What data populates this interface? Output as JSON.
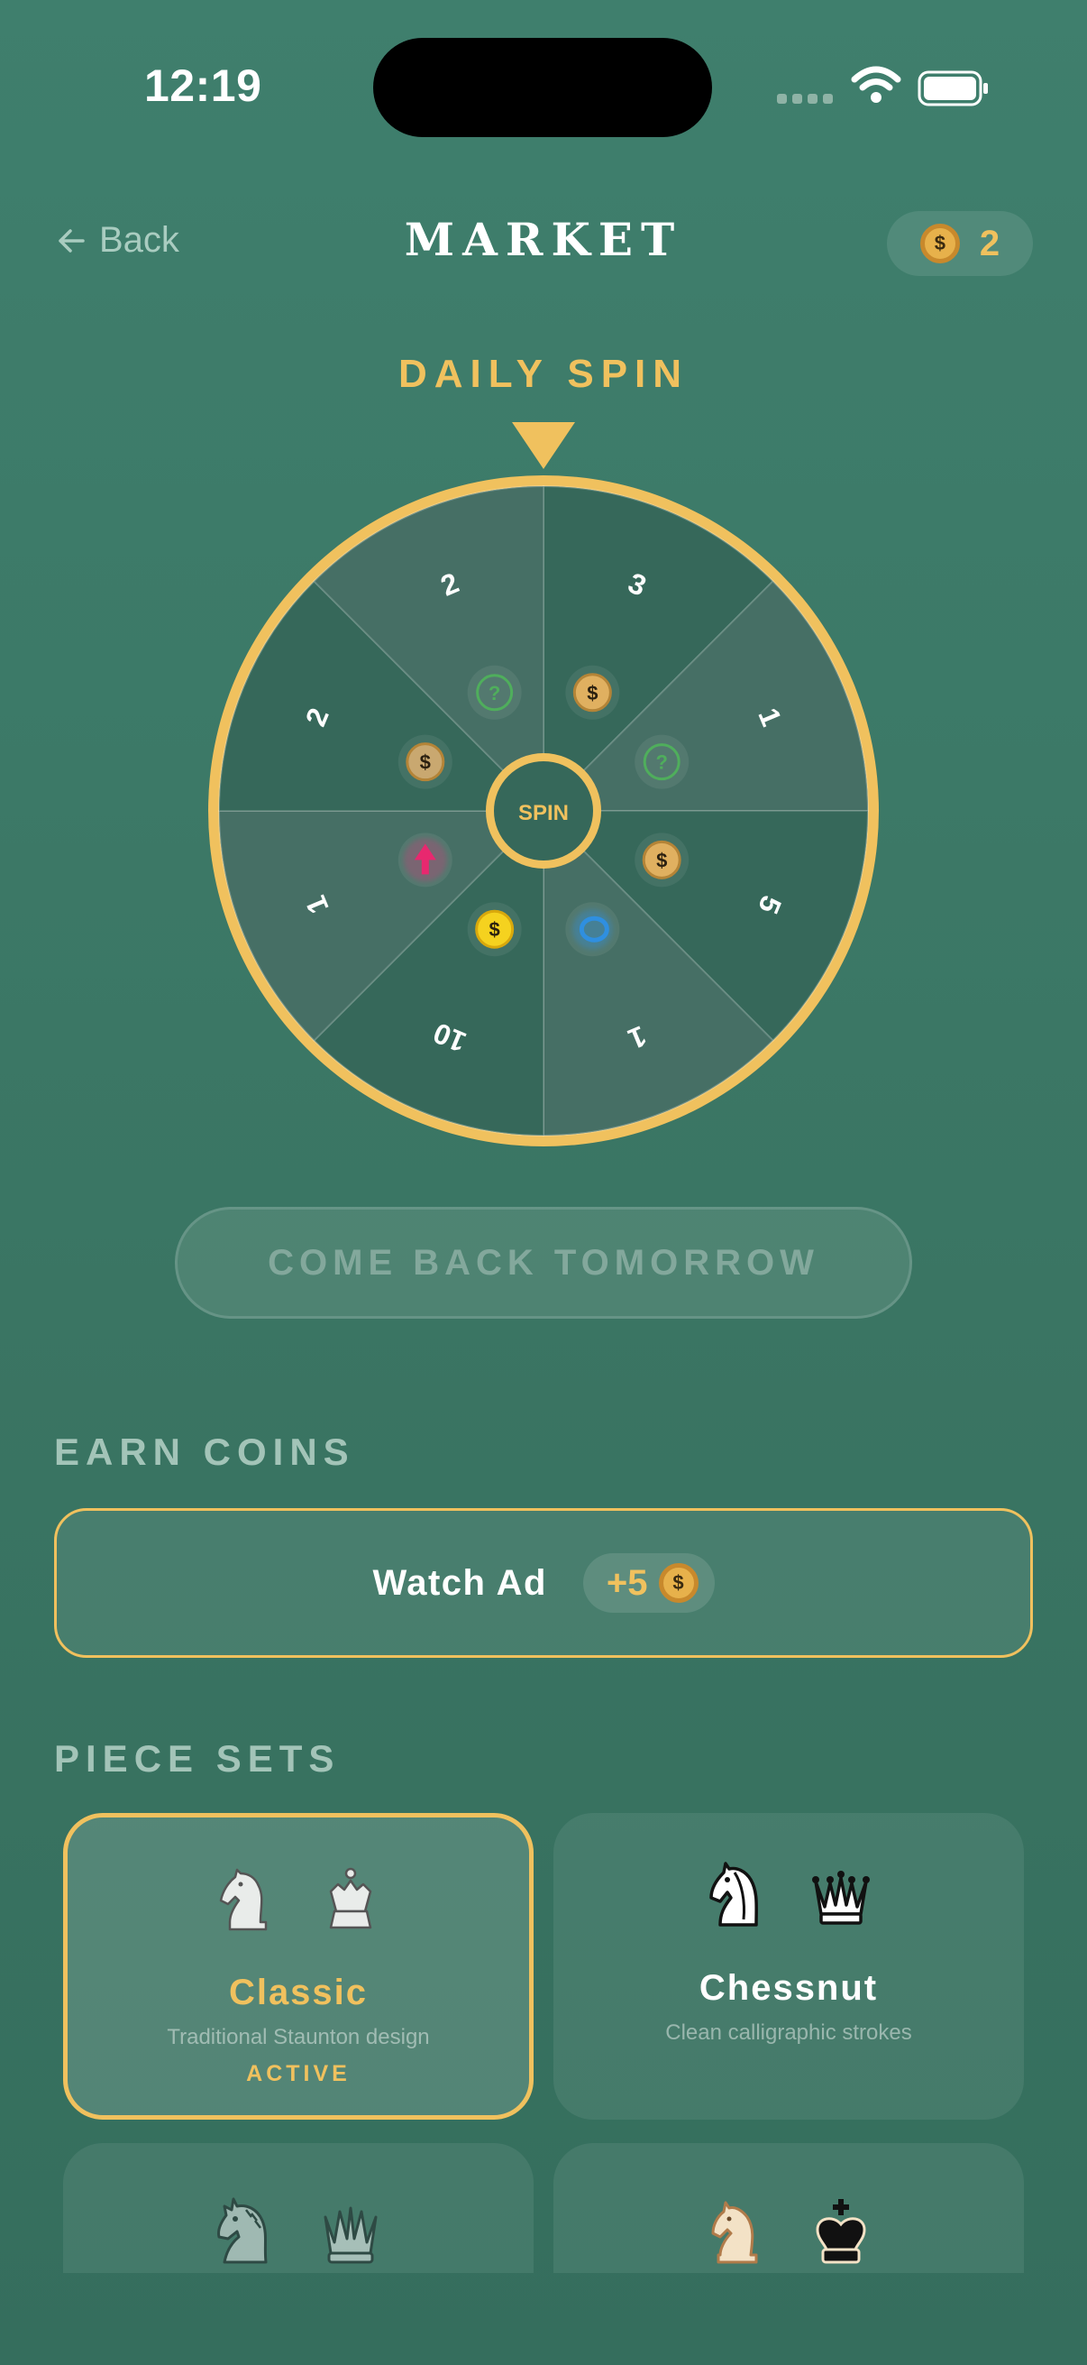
{
  "status_bar": {
    "time": "12:19"
  },
  "header": {
    "back_label": "Back",
    "title": "MARKET",
    "coin_balance": "2"
  },
  "coin_symbol": "$",
  "daily_spin": {
    "title": "DAILY SPIN",
    "center_label": "SPIN",
    "segments": [
      {
        "amount": "3",
        "reward": "coin"
      },
      {
        "amount": "1",
        "reward": "mystery"
      },
      {
        "amount": "5",
        "reward": "coin"
      },
      {
        "amount": "1",
        "reward": "ring"
      },
      {
        "amount": "10",
        "reward": "gold-coin"
      },
      {
        "amount": "1",
        "reward": "pink-gem"
      },
      {
        "amount": "2",
        "reward": "coin"
      },
      {
        "amount": "2",
        "reward": "mystery"
      }
    ],
    "button_label": "COME BACK TOMORROW"
  },
  "earn_coins": {
    "section_title": "EARN COINS",
    "ad_label": "Watch Ad",
    "ad_reward": "+5"
  },
  "piece_sets": {
    "section_title": "PIECE SETS",
    "items": [
      {
        "name": "Classic",
        "description": "Traditional Staunton design",
        "status": "ACTIVE"
      },
      {
        "name": "Chessnut",
        "description": "Clean calligraphic strokes"
      },
      {
        "name": ""
      },
      {
        "name": ""
      }
    ]
  },
  "colors": {
    "background": "#3c7866",
    "accent_gold": "#f0c15e",
    "wheel_dark": "#36685a",
    "wheel_light": "#466f65"
  }
}
